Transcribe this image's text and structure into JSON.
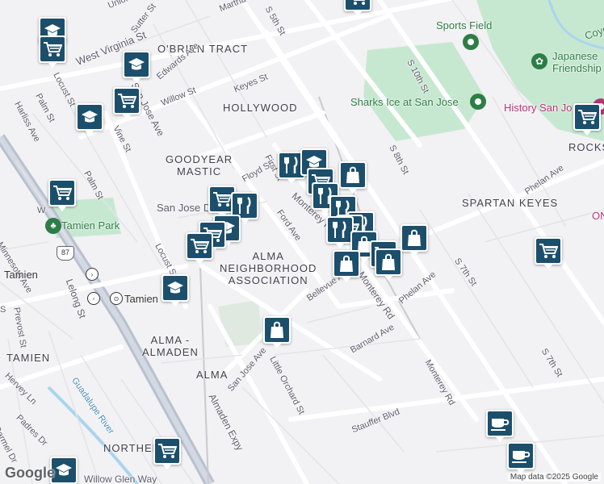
{
  "map": {
    "neighborhoods": [
      {
        "id": "obrien",
        "text": "O'BRIEN TRACT"
      },
      {
        "id": "hollywood",
        "text": "HOLLYWOOD"
      },
      {
        "id": "goodyear",
        "text": "GOODYEAR\nMASTIC"
      },
      {
        "id": "spartan",
        "text": "SPARTAN KEYES"
      },
      {
        "id": "rocks",
        "text": "ROCKS"
      },
      {
        "id": "alma-assoc",
        "text": "ALMA\nNEIGHBORHOOD\nASSOCIATION"
      },
      {
        "id": "alma-almaden",
        "text": "ALMA -\nALMADEN"
      },
      {
        "id": "alma",
        "text": "ALMA"
      },
      {
        "id": "tamien",
        "text": "TAMIEN"
      },
      {
        "id": "northern",
        "text": "NORTHERN C"
      }
    ],
    "streets": [
      {
        "id": "union",
        "text": "Union"
      },
      {
        "id": "w-virginia",
        "text": "West Virginia St"
      },
      {
        "id": "sutter",
        "text": "Sutter St"
      },
      {
        "id": "martha",
        "text": "Martha St"
      },
      {
        "id": "s5th",
        "text": "S 5th St"
      },
      {
        "id": "keyes",
        "text": "Keyes St"
      },
      {
        "id": "willow",
        "text": "Willow St"
      },
      {
        "id": "edwards",
        "text": "Edwards Ave"
      },
      {
        "id": "locust-top",
        "text": "Locust St"
      },
      {
        "id": "palm-top",
        "text": "Palm St"
      },
      {
        "id": "harliss",
        "text": "Harliss Ave"
      },
      {
        "id": "vine",
        "text": "Vine St"
      },
      {
        "id": "san-jose-ave-top",
        "text": "San Jose Ave"
      },
      {
        "id": "palm-mid",
        "text": "Palm St"
      },
      {
        "id": "floyd",
        "text": "Floyd St"
      },
      {
        "id": "first",
        "text": "First St"
      },
      {
        "id": "monterey-top",
        "text": "Monterey Rd"
      },
      {
        "id": "ford",
        "text": "Ford Ave"
      },
      {
        "id": "s10th",
        "text": "S 10th St"
      },
      {
        "id": "s8th",
        "text": "S 8th St"
      },
      {
        "id": "phelan-top",
        "text": "Phelan Ave"
      },
      {
        "id": "s7th-mid",
        "text": "S 7th St"
      },
      {
        "id": "phelan-bot",
        "text": "Phelan Ave"
      },
      {
        "id": "monterey-mid",
        "text": "Monterey Rd"
      },
      {
        "id": "bellevue",
        "text": "Bellevue Ave"
      },
      {
        "id": "barnard",
        "text": "Barnard Ave"
      },
      {
        "id": "s7th-bot",
        "text": "S 7th St"
      },
      {
        "id": "monterey-bot",
        "text": "Monterey Rd"
      },
      {
        "id": "little-orchard",
        "text": "Little Orchard St"
      },
      {
        "id": "san-jose-ave-bot",
        "text": "San Jose Ave"
      },
      {
        "id": "almaden-expy",
        "text": "Almaden Expy"
      },
      {
        "id": "stauffer",
        "text": "Stauffer Blvd"
      },
      {
        "id": "locust-mid",
        "text": "Locust St"
      },
      {
        "id": "minnesota",
        "text": "Minnesota Ave"
      },
      {
        "id": "lelong",
        "text": "Lelong St"
      },
      {
        "id": "prevost",
        "text": "Prevost St"
      },
      {
        "id": "hervey",
        "text": "Hervey Ln"
      },
      {
        "id": "padres",
        "text": "Padres Dr"
      },
      {
        "id": "carmel",
        "text": "Carmel Dr"
      },
      {
        "id": "willow-glen",
        "text": "Willow Glen Way"
      },
      {
        "id": "guadalupe",
        "text": "Guadalupe River"
      },
      {
        "id": "s-left",
        "text": "S"
      },
      {
        "id": "w-left",
        "text": "W"
      },
      {
        "id": "on",
        "text": "ON"
      }
    ],
    "pois": [
      {
        "id": "sports-field",
        "text": "Sports Field",
        "color": "#2d7d46"
      },
      {
        "id": "japanese",
        "text": "Japanese\nFriendship",
        "color": "#2d7d46"
      },
      {
        "id": "sharks-ice",
        "text": "Sharks Ice at San Jose",
        "color": "#2d7d46"
      },
      {
        "id": "history",
        "text": "History San Jo",
        "color": "#b3367a"
      },
      {
        "id": "coyote",
        "text": "Coyote",
        "color": "#2d7d46"
      },
      {
        "id": "tamien-park",
        "text": "Tamien Park",
        "color": "#2d7d46"
      },
      {
        "id": "san-jose-diridon",
        "text": "San Jose D",
        "color": "#5b5b6b"
      },
      {
        "id": "tamien-station",
        "text": "Tamien",
        "color": "#333"
      },
      {
        "id": "tamien-lr",
        "text": "Tamien",
        "color": "#333"
      }
    ],
    "highway_shield": "87",
    "footer": {
      "logo": "Google",
      "attribution": "Map data ©2025 Google"
    },
    "colors": {
      "marker": "#1c4f6b",
      "park": "#c7e8d0",
      "highway": "#b9c1cf",
      "road": "#ffffff",
      "water": "#a8d5f0",
      "rail": "#c9c9d0"
    }
  }
}
